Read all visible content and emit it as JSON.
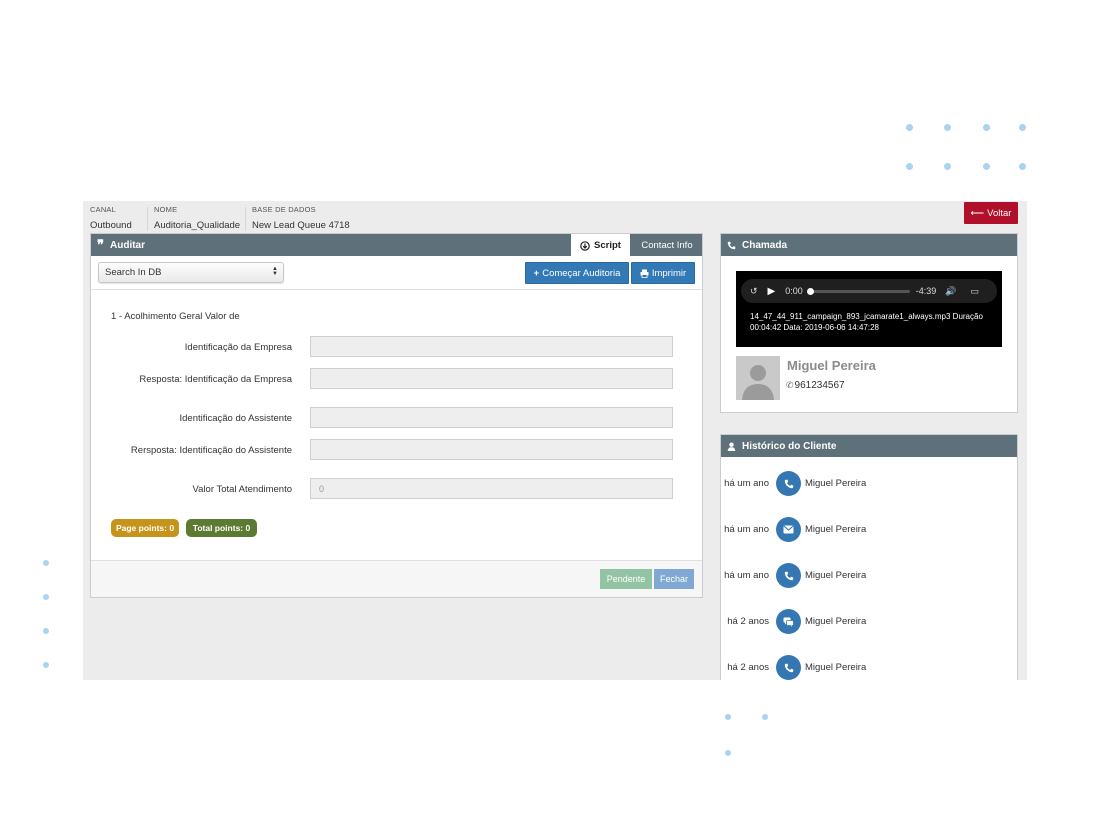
{
  "header": {
    "columns": [
      {
        "label": "CANAL",
        "value": "Outbound"
      },
      {
        "label": "NOME",
        "value": "Auditoria_Qualidade"
      },
      {
        "label": "BASE DE DADOS",
        "value": "New Lead Queue 4718"
      }
    ],
    "back_button": "Voltar"
  },
  "auditar": {
    "title": "Auditar",
    "tabs": [
      {
        "label": "Script",
        "active": true
      },
      {
        "label": "Contact Info",
        "active": false
      }
    ],
    "select": {
      "value": "Search In DB"
    },
    "buttons": {
      "start": "Começar Auditoria",
      "print": "Imprimir"
    },
    "section_title": "1 - Acolhimento Geral Valor de",
    "fields": [
      {
        "label": "Identificação da Empresa",
        "value": ""
      },
      {
        "label": "Resposta: Identificação da Empresa",
        "value": ""
      },
      {
        "label": "Identificação do Assistente",
        "value": ""
      },
      {
        "label": "Rersposta: Identificação do Assistente",
        "value": ""
      },
      {
        "label": "Valor Total Atendimento",
        "value": "0"
      }
    ],
    "badges": {
      "page_points": "Page points:  0",
      "total_points": "Total points:  0"
    },
    "footer": {
      "pending": "Pendente",
      "close": "Fechar"
    }
  },
  "chamada": {
    "title": "Chamada",
    "player": {
      "current_time": "0:00",
      "remaining": "-4:39",
      "progress": 0,
      "caption": "14_47_44_911_campaign_893_jcamarate1_always.mp3 Duração 00:04:42 Data: 2019-06-06 14:47:28"
    },
    "contact": {
      "name": "Miguel Pereira",
      "phone": "961234567"
    }
  },
  "historico": {
    "title": "Histórico do Cliente",
    "items": [
      {
        "time": "há um ano",
        "icon": "phone-icon",
        "name": "Miguel Pereira"
      },
      {
        "time": "há um ano",
        "icon": "envelope-icon",
        "name": "Miguel Pereira"
      },
      {
        "time": "há um ano",
        "icon": "phone-icon",
        "name": "Miguel Pereira"
      },
      {
        "time": "há 2 anos",
        "icon": "chat-icon",
        "name": "Miguel Pereira"
      },
      {
        "time": "há 2 anos",
        "icon": "phone-icon",
        "name": "Miguel Pereira"
      }
    ]
  },
  "colors": {
    "panel_header": "#5e7079",
    "primary": "#3379b5",
    "danger": "#b0102a",
    "page_points_badge": "#c6931b",
    "total_points_badge": "#5d7a32",
    "pending_button": "#92c3a3",
    "close_button": "#7fa8d2"
  }
}
